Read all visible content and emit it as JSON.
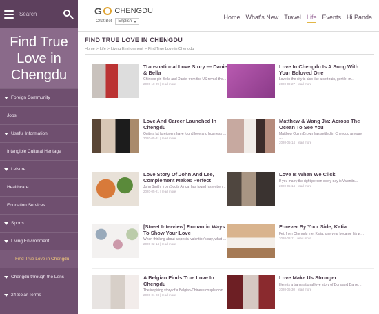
{
  "sidebar": {
    "search_placeholder": "Search",
    "hero_title": "Find True Love in Chengdu",
    "menu": [
      {
        "label": "Foreign Community",
        "arrow": true
      },
      {
        "label": "Jobs",
        "arrow": false
      },
      {
        "label": "Useful Information",
        "arrow": true
      },
      {
        "label": "Intangible Cultural Heritage",
        "arrow": false
      },
      {
        "label": "Leisure",
        "arrow": true
      },
      {
        "label": "Healthcare",
        "arrow": false
      },
      {
        "label": "Education Services",
        "arrow": false
      },
      {
        "label": "Sports",
        "arrow": true
      },
      {
        "label": "Living Environment",
        "arrow": true
      }
    ],
    "active_sub": "Find True Love in Chengdu",
    "menu_after": [
      {
        "label": "Chengdu through the Lens",
        "arrow": true
      },
      {
        "label": "24 Solar Terms",
        "arrow": true
      }
    ]
  },
  "header": {
    "logo_go": "G",
    "logo_city": "CHENGDU",
    "lang_label": "Chat Bot",
    "lang_value": "English",
    "nav": [
      "Home",
      "What's New",
      "Travel",
      "Life",
      "Events",
      "Hi Panda"
    ],
    "nav_active": "Life"
  },
  "main": {
    "title": "FIND TRUE LOVE IN CHENGDU",
    "breadcrumb": [
      "Home",
      ">",
      "Life",
      ">",
      "Living Environment",
      ">",
      "Find True Love in Chengdu"
    ],
    "articles": [
      {
        "title": "Transnational Love Story — Daniel & Bella",
        "excerpt": "Chinese girl Bella and Daniel from the US reveal the…",
        "meta": "2020-10-09 | read more",
        "thumb": "photo-couple-red"
      },
      {
        "title": "Love In Chengdu Is A Song With Your Beloved One",
        "excerpt": "Love in the city is also like a soft rain, gentle, m…",
        "meta": "2020-09-27 | read more",
        "thumb": "graphic-purple"
      },
      {
        "title": "Love And Career Launched In Chengdu",
        "excerpt": "Quite a lot foreigners have found love and business …",
        "meta": "2020-05-31 | read more",
        "thumb": "photo-couple-dark"
      },
      {
        "title": "Matthew & Wang Jia: Across The Ocean To See You",
        "excerpt": "Matthew Quinn Brown has settled in Chengdu anyway …",
        "meta": "2020-05-14 | read more",
        "thumb": "photo-wedding"
      },
      {
        "title": "Love Story Of John And Lee, Complement Makes Perfect",
        "excerpt": "John Smith, from South Africa, has found his written…",
        "meta": "2020-05-21 | read more",
        "thumb": "photo-food"
      },
      {
        "title": "Love Is When We Click",
        "excerpt": "If you marry the right person every day is Valentin…",
        "meta": "2020-05-14 | read more",
        "thumb": "photo-family"
      },
      {
        "title": "[Street Interview] Romantic Ways To Show Your Love",
        "excerpt": "When thinking about a special valentine's day, what …",
        "meta": "2020-02-14 | read more",
        "thumb": "photo-collage"
      },
      {
        "title": "Forever By Your Side, Katia",
        "excerpt": "Fei, from Chengdu met Katia, one year became his w…",
        "meta": "2020-02-11 | read more",
        "thumb": "photo-dinner"
      },
      {
        "title": "A Belgian Finds True Love In Chengdu",
        "excerpt": "The inspiring story of a Belgian-Chinese couple doin…",
        "meta": "2020-01-23 | read more",
        "thumb": "photo-bride"
      },
      {
        "title": "Love Make Us Stronger",
        "excerpt": "Here is a transnational love story of Dora and Danie…",
        "meta": "2020-06-30 | read more",
        "thumb": "photo-collage-red"
      }
    ]
  }
}
